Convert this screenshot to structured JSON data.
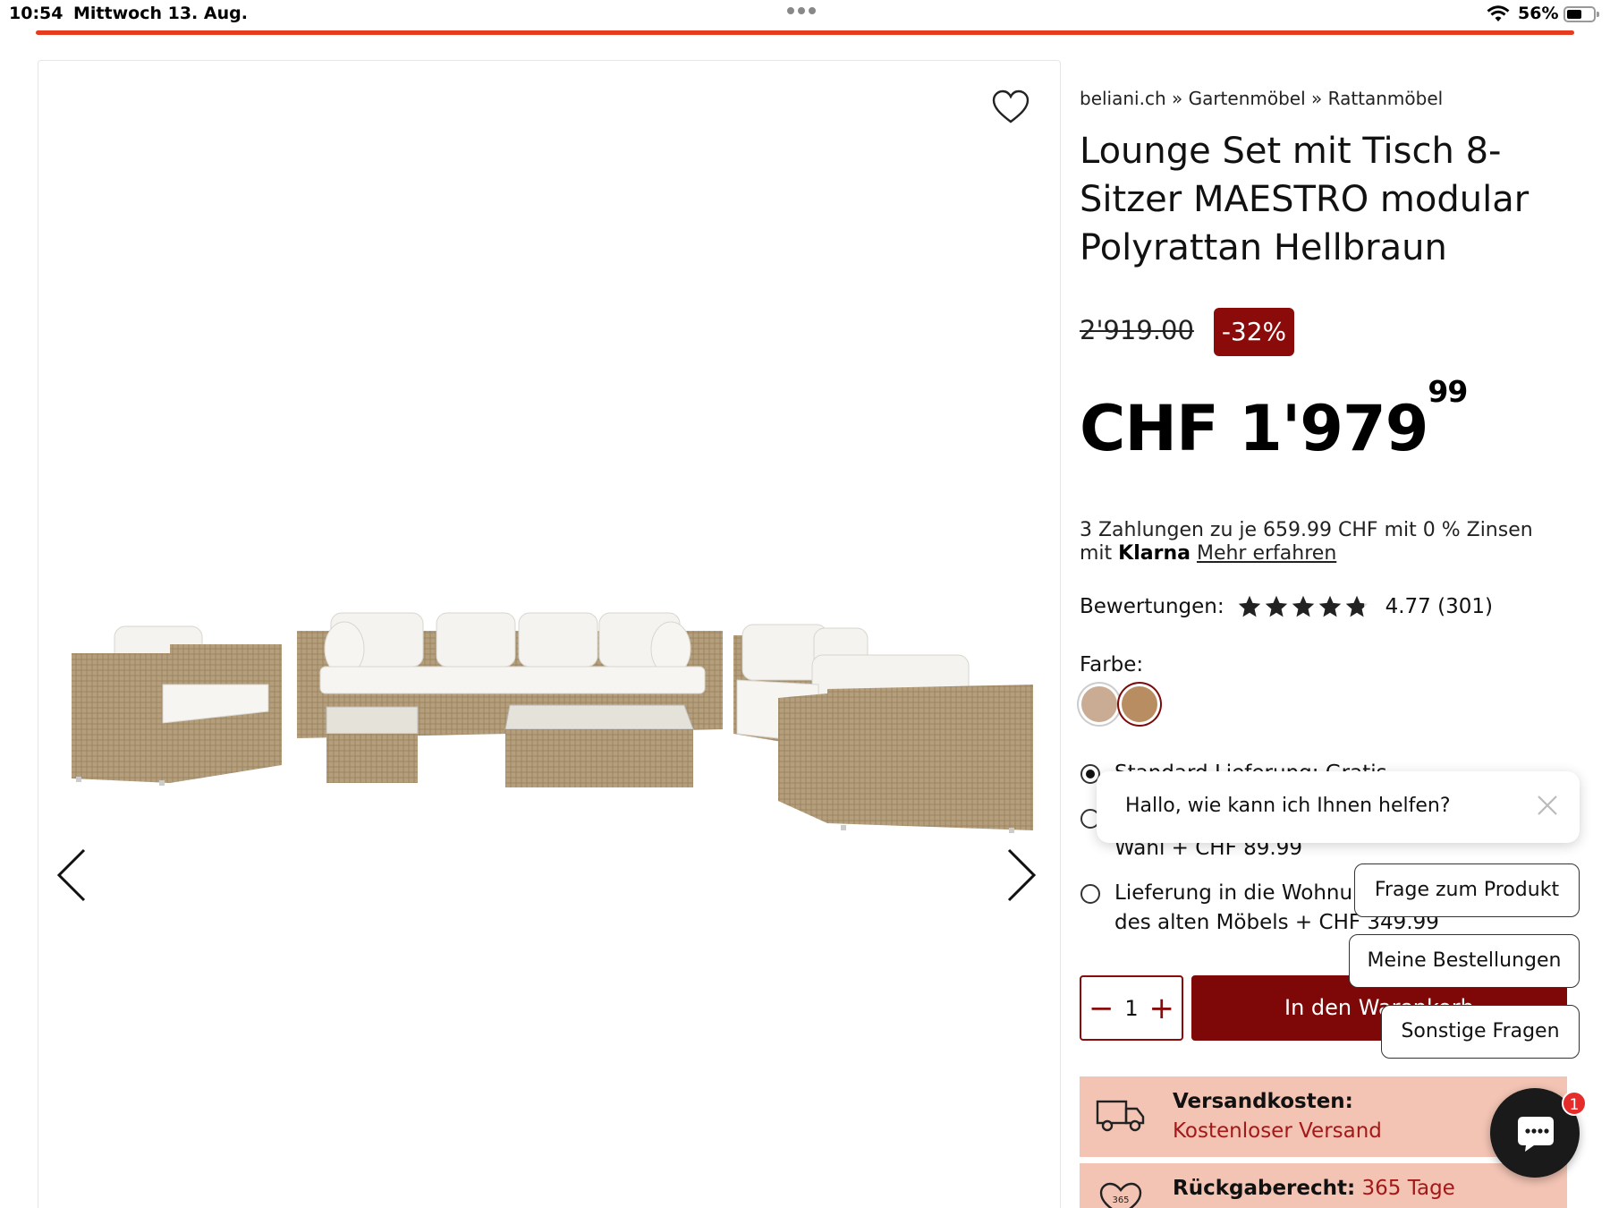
{
  "status_bar": {
    "time": "10:54",
    "date": "Mittwoch 13. Aug.",
    "battery": "56%",
    "battery_level": 0.56
  },
  "page_progress": 1.0,
  "breadcrumb": "beliani.ch » Gartenmöbel » Rattanmöbel",
  "product": {
    "title": "Lounge Set mit Tisch 8-Sitzer MAESTRO modular Polyrattan Hellbraun",
    "old_price": "2'919.00",
    "discount": "-32%",
    "price_main": "CHF 1'979",
    "price_cents": "99"
  },
  "klarna": {
    "text_pre": "3 Zahlungen zu je 659.99 CHF mit 0 % Zinsen mit ",
    "brand": "Klarna",
    "link": "Mehr erfahren"
  },
  "rating": {
    "label": "Bewertungen:",
    "score_text": "4.77 (301)",
    "score": 4.77,
    "max": 5
  },
  "color": {
    "label": "Farbe:",
    "swatches": [
      "#c9ac93",
      "#b98d62"
    ],
    "selected_index": 1
  },
  "shipping": {
    "options": [
      {
        "text": "Standard Lieferung: Gratis",
        "checked": true
      },
      {
        "text": "Wahl + CHF 89.99",
        "checked": false
      },
      {
        "text": "Lieferung in die Wohnu… des alten Möbels + CHF 349.99",
        "checked": false
      }
    ],
    "opt3_line1": "Lieferung in die Wohnu",
    "opt3_line2": "des alten Möbels + CHF 349.99"
  },
  "quantity": {
    "minus": "−",
    "value": "1",
    "plus": "+"
  },
  "cart_button": "In den Warenkorb",
  "info": {
    "shipping_label": "Versandkosten:",
    "shipping_value": "Kostenloser Versand",
    "return_label": "Rückgaberecht:",
    "return_value": "365 Tage",
    "return_icon_text": "365"
  },
  "chat": {
    "greeting": "Hallo, wie kann ich Ihnen helfen?",
    "chips": [
      "Frage zum Produkt",
      "Meine Bestellungen",
      "Sonstige Fragen"
    ],
    "badge": "1"
  },
  "colors": {
    "accent_red": "#8b0a0a",
    "progress_orange": "#e63b1f",
    "info_bg": "#f3c4b4"
  }
}
